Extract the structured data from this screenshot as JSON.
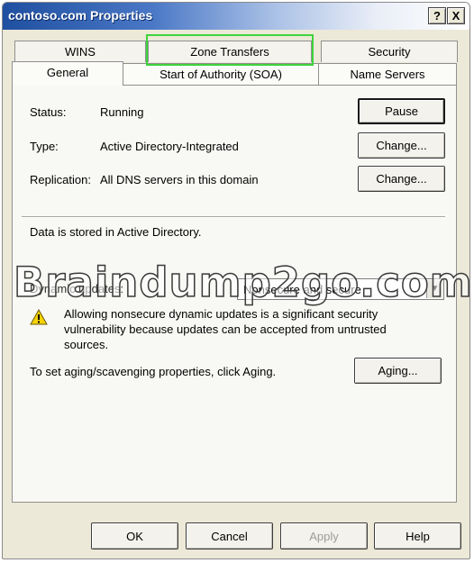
{
  "window": {
    "title": "contoso.com Properties",
    "help_glyph": "?",
    "close_glyph": "X"
  },
  "tabs": {
    "back_row": [
      "WINS",
      "Zone Transfers",
      "Security"
    ],
    "front_row": [
      "General",
      "Start of Authority (SOA)",
      "Name Servers"
    ],
    "selected": "Zone Transfers"
  },
  "general": {
    "status_label": "Status:",
    "status_value": "Running",
    "pause_button": "Pause",
    "type_label": "Type:",
    "type_value": "Active Directory-Integrated",
    "type_change_button": "Change...",
    "replication_label": "Replication:",
    "replication_value": "All DNS servers in this domain",
    "replication_change_button": "Change...",
    "storage_note": "Data is stored in Active Directory.",
    "dynamic_updates_label": "Dynamic updates:",
    "dynamic_updates_value": "Nonsecure and secure",
    "warning_text": "Allowing nonsecure dynamic updates is a significant security vulnerability because updates can be accepted from untrusted sources.",
    "aging_text": "To set aging/scavenging properties, click Aging.",
    "aging_button": "Aging..."
  },
  "footer": {
    "ok": "OK",
    "cancel": "Cancel",
    "apply": "Apply",
    "help": "Help"
  },
  "watermark": "Braindump2go.com",
  "icons": {
    "warning": "warning-icon"
  }
}
